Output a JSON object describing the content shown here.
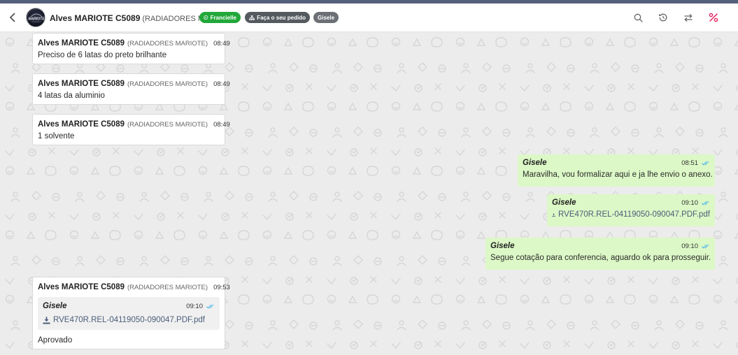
{
  "header": {
    "contact_name": "Alves MARIOTE C5089",
    "contact_company": "(RADIADORES MARIOTE)",
    "avatar_text": "MARIOTE",
    "tags": [
      {
        "label": "Francielle",
        "color": "#22a83a",
        "icon": "whatsapp-icon"
      },
      {
        "label": "Faça o seu pedido",
        "color": "#555a60",
        "icon": "sitemap-icon"
      },
      {
        "label": "Gisele",
        "color": "#6c7076"
      }
    ],
    "actions": [
      "search-icon",
      "history-icon",
      "transfer-icon",
      "percent-icon"
    ],
    "accent_color": "#e0245e"
  },
  "messages": {
    "m1": {
      "sender": "Alves MARIOTE C5089",
      "company": "(RADIADORES MARIOTE)",
      "time": "08:49",
      "text": "Preciso de 6 latas do preto brilhante"
    },
    "m2": {
      "sender": "Alves MARIOTE C5089",
      "company": "(RADIADORES MARIOTE)",
      "time": "08:49",
      "text": "4 latas da aluminio"
    },
    "m3": {
      "sender": "Alves MARIOTE C5089",
      "company": "(RADIADORES MARIOTE)",
      "time": "08:49",
      "text": "1 solvente"
    },
    "m4": {
      "sender": "Gisele",
      "time": "08:51",
      "text": "Maravilha, vou formalizar aqui e ja lhe envio o anexo."
    },
    "m5": {
      "sender": "Gisele",
      "time": "09:10",
      "file": "RVE470R.REL-04119050-090047.PDF.pdf"
    },
    "m6": {
      "sender": "Gisele",
      "time": "09:10",
      "text": "Segue cotação para conferencia, aguardo ok para prosseguir."
    },
    "m7": {
      "sender": "Alves MARIOTE C5089",
      "company": "(RADIADORES MARIOTE)",
      "time": "09:53",
      "quote": {
        "sender": "Gisele",
        "time": "09:10",
        "file": "RVE470R.REL-04119050-090047.PDF.pdf"
      },
      "text": "Aprovado"
    }
  },
  "colors": {
    "outgoing": "#dcf8c6",
    "incoming": "#ffffff",
    "read_ticks": "#4fb6ec",
    "link": "#4b5d7a"
  }
}
